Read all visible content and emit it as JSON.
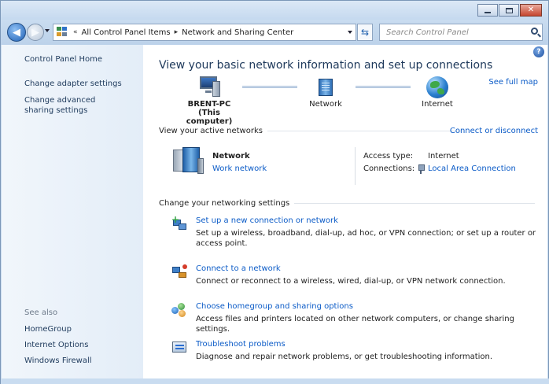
{
  "window": {
    "caption_buttons": {
      "minimize": "minimize-icon",
      "maximize": "maximize-icon",
      "close": "close-icon"
    }
  },
  "address_bar": {
    "prefix": "«",
    "crumbs": [
      "All Control Panel Items",
      "Network and Sharing Center"
    ],
    "separator": "▸",
    "search_placeholder": "Search Control Panel"
  },
  "sidebar": {
    "home": "Control Panel Home",
    "links": [
      "Change adapter settings",
      "Change advanced sharing settings"
    ],
    "see_also_label": "See also",
    "see_also": [
      "HomeGroup",
      "Internet Options",
      "Windows Firewall"
    ]
  },
  "main": {
    "help": "?",
    "title": "View your basic network information and set up connections",
    "see_full_map": "See full map",
    "map": {
      "computer_name": "BRENT-PC",
      "computer_sub": "(This computer)",
      "network": "Network",
      "internet": "Internet"
    },
    "active_networks_heading": "View your active networks",
    "connect_disconnect": "Connect or disconnect",
    "active_network": {
      "name": "Network",
      "type": "Work network",
      "access_type_label": "Access type:",
      "access_type_value": "Internet",
      "connections_label": "Connections:",
      "connections_value": "Local Area Connection"
    },
    "settings_heading": "Change your networking settings",
    "tasks": [
      {
        "icon": "new-connection-icon",
        "title": "Set up a new connection or network",
        "desc": "Set up a wireless, broadband, dial-up, ad hoc, or VPN connection; or set up a router or access point."
      },
      {
        "icon": "connect-network-icon",
        "title": "Connect to a network",
        "desc": "Connect or reconnect to a wireless, wired, dial-up, or VPN network connection."
      },
      {
        "icon": "homegroup-icon",
        "title": "Choose homegroup and sharing options",
        "desc": "Access files and printers located on other network computers, or change sharing settings."
      },
      {
        "icon": "troubleshoot-icon",
        "title": "Troubleshoot problems",
        "desc": "Diagnose and repair network problems, or get troubleshooting information."
      }
    ]
  },
  "colors": {
    "link": "#0b5bc7",
    "title": "#1e395b",
    "chrome": "#c9dcf0",
    "sidebar": "#e3edf8"
  }
}
